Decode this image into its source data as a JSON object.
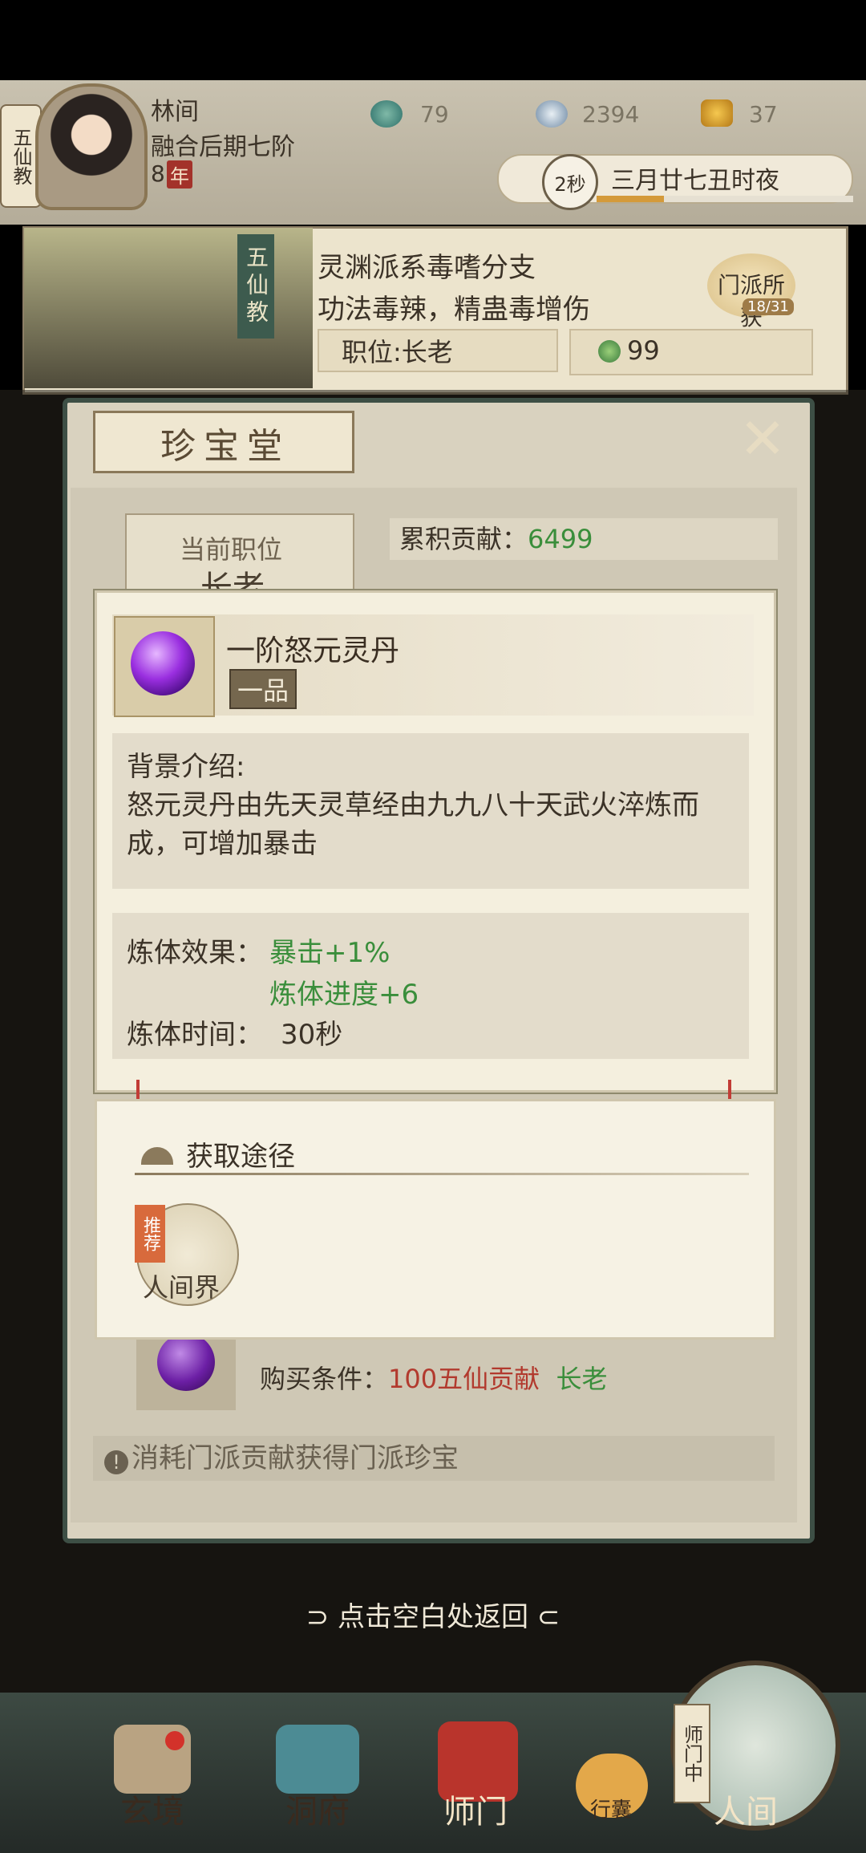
{
  "header": {
    "sect_tag": "五仙教",
    "hero_name": "林间",
    "hero_rank": "融合后期七阶",
    "hero_years": "8",
    "hero_years_unit": "年",
    "res1": "79",
    "res2": "2394",
    "res3": "37",
    "timer": "2秒",
    "date": "三月廿七丑时夜"
  },
  "sect": {
    "banner": "五仙教",
    "desc1": "灵渊派系毒嗜分支",
    "desc2": "功法毒辣，精蛊毒增伤",
    "position": "职位:长老",
    "contribution": "99",
    "gain_label": "门派所获",
    "gain_count": "18/31"
  },
  "hall": {
    "title": "珍宝堂",
    "close": "✕",
    "current_position_label": "当前职位",
    "current_position_value": "长老",
    "cumulative_label": "累积贡献：",
    "cumulative_value": "6499"
  },
  "item": {
    "name": "一阶怒元灵丹",
    "grade": "一品",
    "bg_title": "背景介绍:",
    "bg_text": "怒元灵丹由先天灵草经由九九八十天武火淬炼而成，可增加暴击",
    "effect_label": "炼体效果：",
    "effect_1": "暴击+1%",
    "effect_2": "炼体进度+6",
    "time_label": "炼体时间：",
    "time_value": "30秒"
  },
  "acquire": {
    "title": "获取途径",
    "recommend": "推荐",
    "world": "人间界"
  },
  "item2": {
    "cond_label": "购买条件：",
    "cost": "100五仙贡献",
    "position": "长老"
  },
  "notice": {
    "icon": "!",
    "text": "消耗门派贡献获得门派珍宝"
  },
  "back_hint": "⊃ 点击空白处返回 ⊂",
  "nav": {
    "n1": "玄境",
    "n2": "洞府",
    "n3": "师门",
    "n4": "行囊",
    "n5": "人间",
    "n5_tag": "师门中"
  },
  "colors": {
    "green": "#3a8e3b",
    "red": "#b23a2e",
    "panel": "#3d4f45"
  }
}
